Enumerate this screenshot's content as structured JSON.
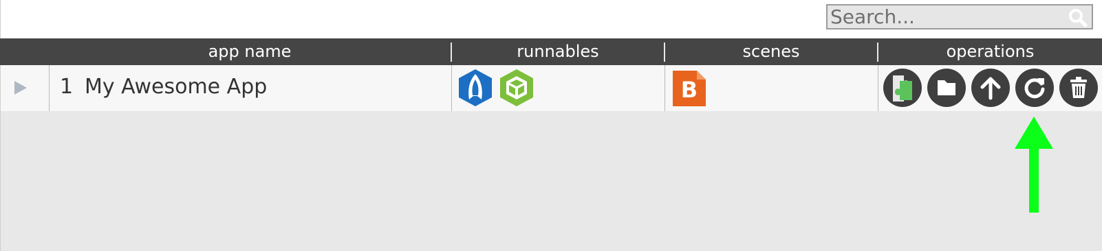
{
  "search": {
    "placeholder": "Search...",
    "value": ""
  },
  "table": {
    "columns": [
      "app name",
      "runnables",
      "scenes",
      "operations"
    ],
    "rows": [
      {
        "index": "1",
        "app_name": "My Awesome App",
        "runnables": [
          "rocket-runnable-icon",
          "cube-runnable-icon"
        ],
        "scenes": [
          "b-scene-icon"
        ],
        "operations": [
          "puzzle-icon",
          "folder-icon",
          "upload-icon",
          "refresh-icon",
          "trash-icon"
        ]
      }
    ]
  },
  "colors": {
    "header_bg": "#454545",
    "row_bg": "#f7f7f7",
    "body_bg": "#e8e8e8",
    "op_button": "#3f3f3f",
    "annotation_arrow": "#0bff19",
    "rocket_blue": "#1c6fc2",
    "cube_green": "#7dbf3b",
    "scene_orange": "#e8641e"
  }
}
